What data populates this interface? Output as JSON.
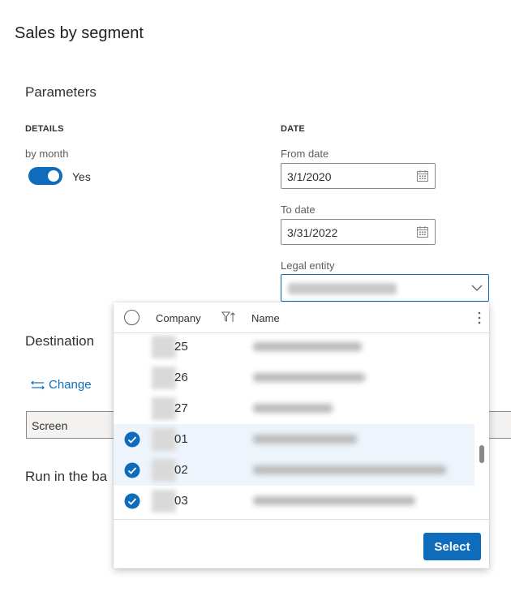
{
  "page": {
    "title": "Sales by segment"
  },
  "parameters": {
    "title": "Parameters",
    "details": {
      "heading": "DETAILS",
      "by_month_label": "by month",
      "by_month_value": "Yes"
    },
    "date": {
      "heading": "DATE",
      "from_label": "From date",
      "from_value": "3/1/2020",
      "to_label": "To date",
      "to_value": "3/31/2022",
      "legal_entity_label": "Legal entity"
    }
  },
  "destination": {
    "title": "Destination",
    "change_label": "Change",
    "screen_value": "Screen"
  },
  "background": {
    "title": "Run in the ba"
  },
  "dropdown": {
    "columns": {
      "company": "Company",
      "name": "Name"
    },
    "rows": [
      {
        "code": "25",
        "selected": false
      },
      {
        "code": "26",
        "selected": false
      },
      {
        "code": "27",
        "selected": false
      },
      {
        "code": "01",
        "selected": true
      },
      {
        "code": "02",
        "selected": true
      },
      {
        "code": "03",
        "selected": true
      }
    ],
    "select_label": "Select"
  },
  "colors": {
    "accent": "#0f6cbd",
    "selected_row": "#eef4fc"
  }
}
